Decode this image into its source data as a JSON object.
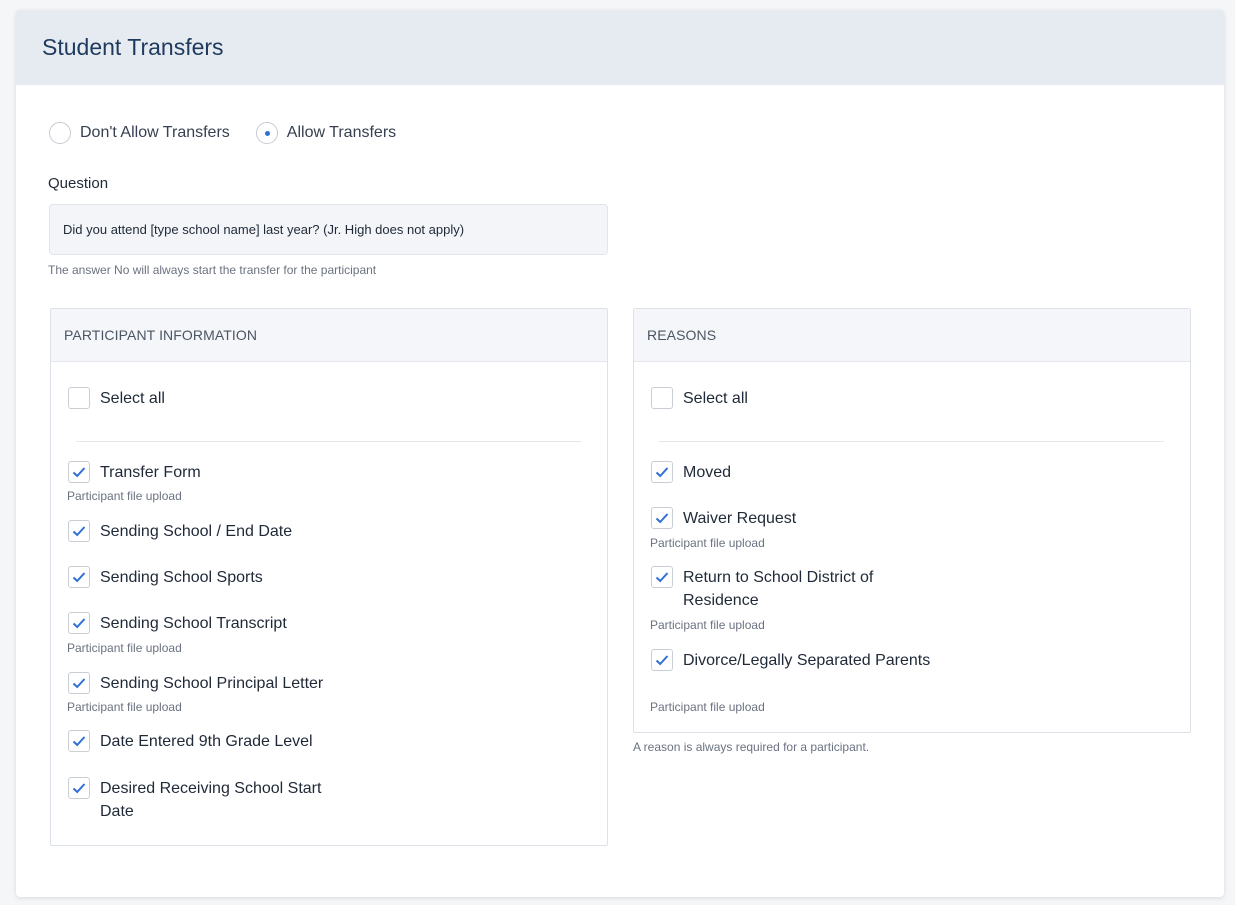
{
  "header": {
    "title": "Student Transfers"
  },
  "transfer_mode": {
    "options": [
      {
        "label": "Don't Allow Transfers",
        "selected": false
      },
      {
        "label": "Allow Transfers",
        "selected": true
      }
    ]
  },
  "question": {
    "label": "Question",
    "value": "Did you attend [type school name] last year? (Jr. High does not apply)",
    "help": "The answer No will always start the transfer for the participant"
  },
  "participant_info": {
    "title": "PARTICIPANT INFORMATION",
    "select_all": "Select all",
    "items": [
      {
        "label": "Transfer Form",
        "sub": "Participant file upload",
        "checked": true
      },
      {
        "label": "Sending School / End Date",
        "checked": true
      },
      {
        "label": "Sending School Sports",
        "checked": true
      },
      {
        "label": "Sending School Transcript",
        "sub": "Participant file upload",
        "checked": true
      },
      {
        "label": "Sending School Principal Letter",
        "sub": "Participant file upload",
        "checked": true
      },
      {
        "label": "Date Entered 9th Grade Level",
        "checked": true
      },
      {
        "label": "Desired Receiving School Start Date",
        "checked": true
      }
    ]
  },
  "reasons": {
    "title": "REASONS",
    "select_all": "Select all",
    "items": [
      {
        "label": "Moved",
        "checked": true
      },
      {
        "label": "Waiver Request",
        "sub": "Participant file upload",
        "checked": true
      },
      {
        "label": "Return to School District of Residence",
        "sub": "Participant file upload",
        "checked": true
      },
      {
        "label": "Divorce/Legally Separated Parents",
        "sub": "Participant file upload",
        "checked": true
      }
    ],
    "help": "A reason is always required for a participant."
  },
  "colors": {
    "accent": "#2f6fd6",
    "header_bg": "#e6ebf2",
    "title": "#1e3a5c"
  },
  "icons": {
    "check": "check-icon"
  }
}
